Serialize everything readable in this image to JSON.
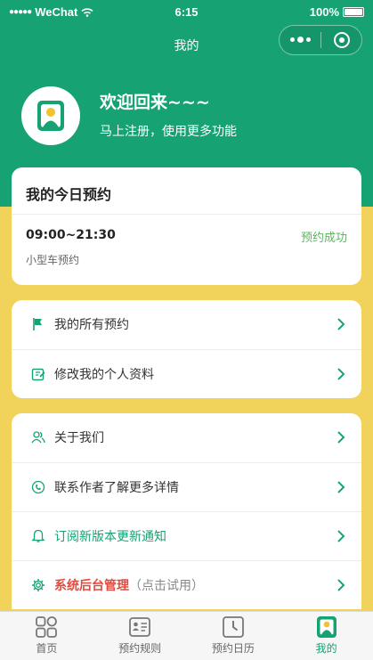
{
  "status_bar": {
    "carrier": "WeChat",
    "time": "6:15",
    "battery": "100%"
  },
  "nav": {
    "title": "我的"
  },
  "profile": {
    "welcome": "欢迎回来~~~",
    "subtitle": "马上注册，使用更多功能"
  },
  "today": {
    "title": "我的今日预约",
    "appointment": {
      "time": "09:00~21:30",
      "status": "预约成功",
      "type": "小型车预约"
    }
  },
  "menu_group_1": [
    {
      "label": "我的所有预约",
      "icon": "flag-icon"
    },
    {
      "label": "修改我的个人资料",
      "icon": "edit-icon"
    }
  ],
  "menu_group_2": [
    {
      "label": "关于我们",
      "icon": "users-icon"
    },
    {
      "label": "联系作者了解更多详情",
      "icon": "contact-icon"
    },
    {
      "label": "订阅新版本更新通知",
      "icon": "bell-icon"
    },
    {
      "label": "系统后台管理",
      "hint": "（点击试用）",
      "icon": "gear-icon"
    }
  ],
  "tabs": [
    {
      "label": "首页",
      "icon": "grid-icon"
    },
    {
      "label": "预约规则",
      "icon": "rules-icon"
    },
    {
      "label": "预约日历",
      "icon": "clock-icon"
    },
    {
      "label": "我的",
      "icon": "profile-icon",
      "active": true
    }
  ],
  "colors": {
    "primary": "#17a273",
    "accent_bg": "#f1d25a",
    "success": "#5bb65e",
    "danger": "#e04b3f"
  }
}
